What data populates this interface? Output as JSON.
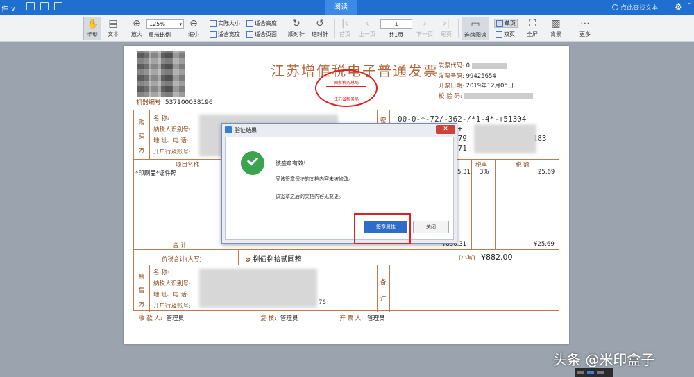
{
  "titlebar": {
    "file_menu": "件 ∨",
    "active_tab": "阅读",
    "search_placeholder": "点此查找文本"
  },
  "toolbar": {
    "hand": "手型",
    "text": "文本",
    "zoom_in": "放大",
    "zoom_value": "125%",
    "display_ratio": "显示比例",
    "zoom_out": "缩小",
    "actual_size": "实际大小",
    "fit_width": "适合宽度",
    "fit_height": "适合高度",
    "fit_page": "适合页面",
    "rotate_cw": "顺时针",
    "rotate_ccw": "逆时针",
    "first_page": "首页",
    "prev_page": "上一页",
    "page_value": "1",
    "total_pages": "共1页",
    "next_page": "下一页",
    "last_page": "尾页",
    "continuous": "连续阅读",
    "single_page": "单页",
    "double_page": "双页",
    "fullscreen": "全屏",
    "background": "背景",
    "more": "更多"
  },
  "invoice": {
    "title": "江苏增值税电子普通发票",
    "machine_label": "机器编号:",
    "machine_no": "537100038196",
    "seal_text_top": "国家税务总局",
    "seal_text_mid": "江苏省税务局",
    "code_label": "发票代码:",
    "code_value": "0",
    "number_label": "发票号码:",
    "number_value": "99425654",
    "date_label": "开票日期:",
    "date_value": "2019年12月05日",
    "check_label": "校 验 码:",
    "buyer_label": [
      "购",
      "买",
      "方"
    ],
    "name_label": "名    称:",
    "taxid_label": "纳税人识别号:",
    "addr_label": "地 址、电 话:",
    "bank_label": "开户行及账号:",
    "password_label": "密",
    "cipher_line1": "00-0-*-72/-362-/*1-4*-+51304",
    "cipher_line2": "/+",
    "cipher_line3": "779",
    "cipher_line4": "271",
    "cipher_tail": "*183",
    "item_header": "项目名称",
    "rate_header": "税率",
    "tax_header": "税  额",
    "item_name": "*印刷品*证件照",
    "item_amount_tail": "5.31",
    "item_rate": "3%",
    "item_tax": "25.69",
    "total_label": "合    计",
    "total_amount": "¥856.31",
    "total_tax": "¥25.69",
    "sum_label": "价税合计(大写)",
    "sum_words": "捌佰捌拾贰圆整",
    "sum_small_label": "(小写)",
    "sum_small": "¥882.00",
    "seller_label": [
      "销",
      "售",
      "方"
    ],
    "seller_bank_tail": "76",
    "remark_label": [
      "备",
      "注"
    ],
    "payee_label": "收 款 人:",
    "payee": "管理员",
    "reviewer_label": "复    核:",
    "reviewer": "管理员",
    "drawer_label": "开 票 人:",
    "drawer": "管理员"
  },
  "dialog": {
    "title": "验证结果",
    "close": "✕",
    "msg_valid": "该签章有效！",
    "msg_unmodified": "受该签章保护的文档内容未被修改。",
    "msg_after": "该签章之后的文档内容无变更。",
    "btn_properties": "签章属性",
    "btn_close": "关闭"
  },
  "watermark": "头条 @米印盒子"
}
